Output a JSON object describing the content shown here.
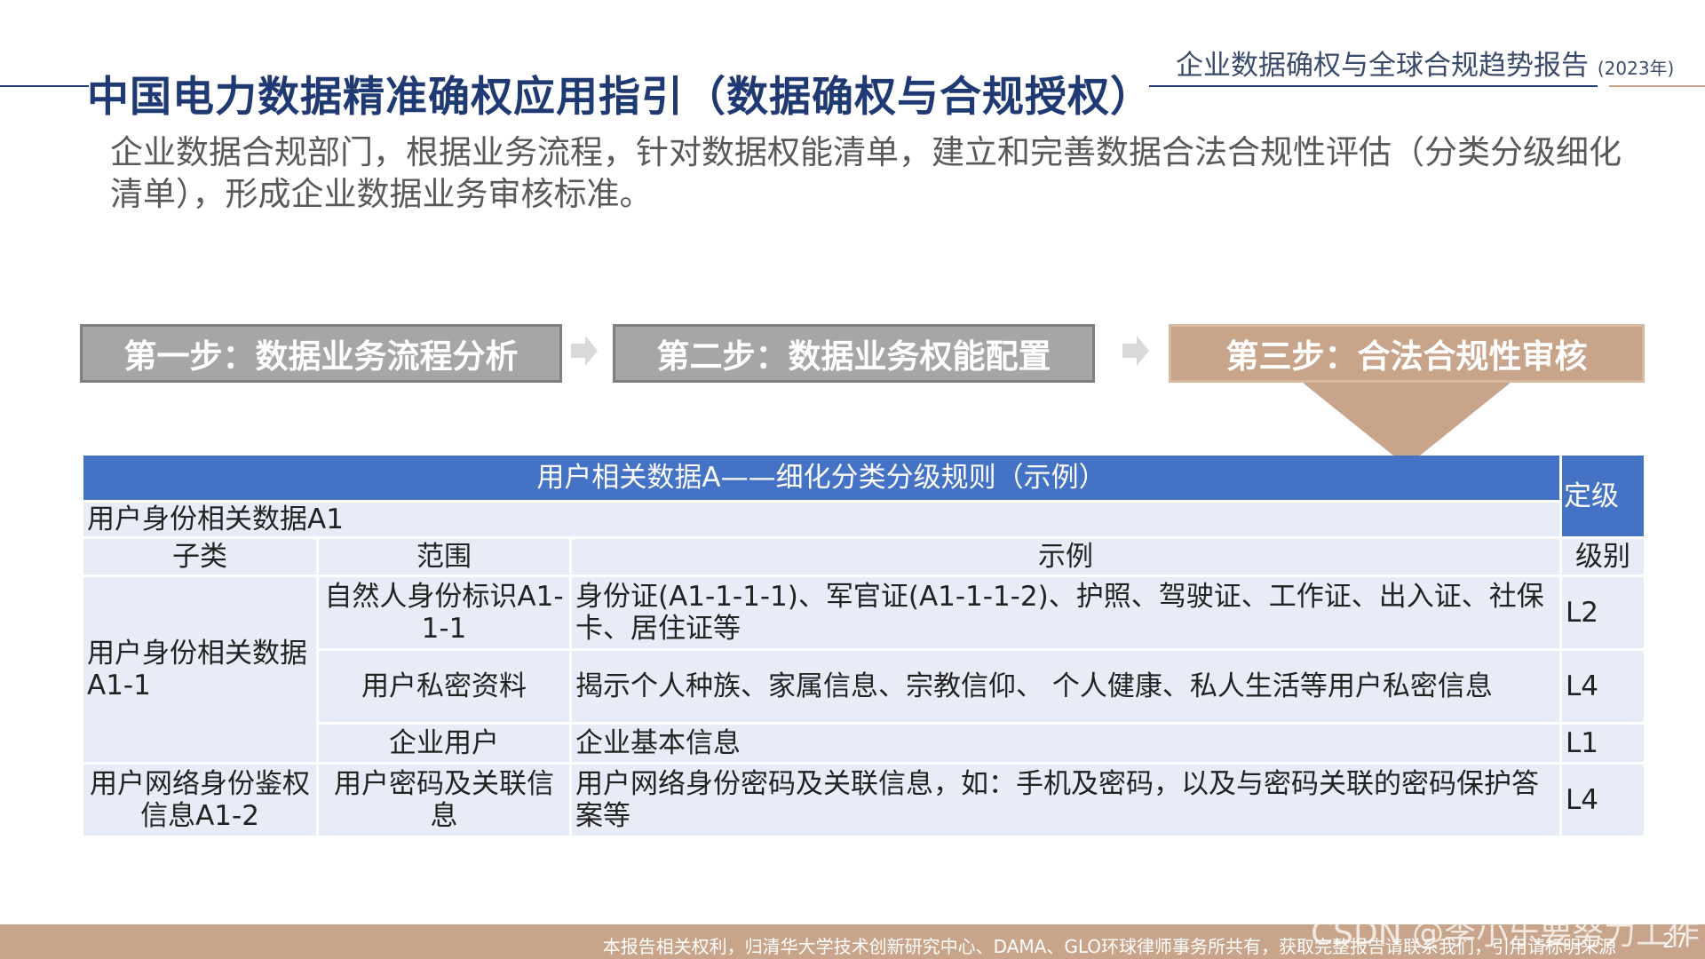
{
  "header": {
    "report_title": "企业数据确权与全球合规趋势报告",
    "report_year": "(2023年)",
    "page_title": "中国电力数据精准确权应用指引（数据确权与合规授权）"
  },
  "intro": "企业数据合规部门，根据业务流程，针对数据权能清单，建立和完善数据合法合规性评估（分类分级细化清单），形成企业数据业务审核标准。",
  "steps": [
    {
      "label": "第一步：数据业务流程分析"
    },
    {
      "label": "第二步：数据业务权能配置"
    },
    {
      "label": "第三步：合法合规性审核"
    }
  ],
  "table": {
    "title": "用户相关数据A——细化分类分级规则（示例）",
    "grade_header": "定级",
    "section": "用户身份相关数据A1",
    "columns": [
      "子类",
      "范围",
      "示例",
      "级别"
    ],
    "groups": [
      {
        "subcategory": "用户身份相关数据A1-1",
        "rows": [
          {
            "scope": "自然人身份标识A1-1-1",
            "example": "身份证(A1-1-1-1)、军官证(A1-1-1-2)、护照、驾驶证、工作证、出入证、社保卡、居住证等",
            "level": "L2"
          },
          {
            "scope": "用户私密资料",
            "example": "揭示个人种族、家属信息、宗教信仰、 个人健康、私人生活等用户私密信息",
            "level": "L4"
          },
          {
            "scope": "企业用户",
            "example": "企业基本信息",
            "level": "L1"
          }
        ]
      },
      {
        "subcategory": "用户网络身份鉴权信息A1-2",
        "rows": [
          {
            "scope": "用户密码及关联信息",
            "example": "用户网络身份密码及关联信息，如：手机及密码，以及与密码关联的密码保护答案等",
            "level": "L4"
          }
        ]
      }
    ]
  },
  "footer": {
    "text": "本报告相关权利，归清华大学技术创新研究中心、DAMA、GLO环球律师事务所共有，获取完整报告请联系我们，引用请标明来源",
    "page_number": "27",
    "watermark": "CSDN @李小乐要努力工作"
  },
  "colors": {
    "title_blue": "#1f3a73",
    "table_header": "#4472c4",
    "table_cell": "#e8ecf6",
    "accent_tan": "#c8a48b",
    "step_gray": "#a6a6a6"
  }
}
